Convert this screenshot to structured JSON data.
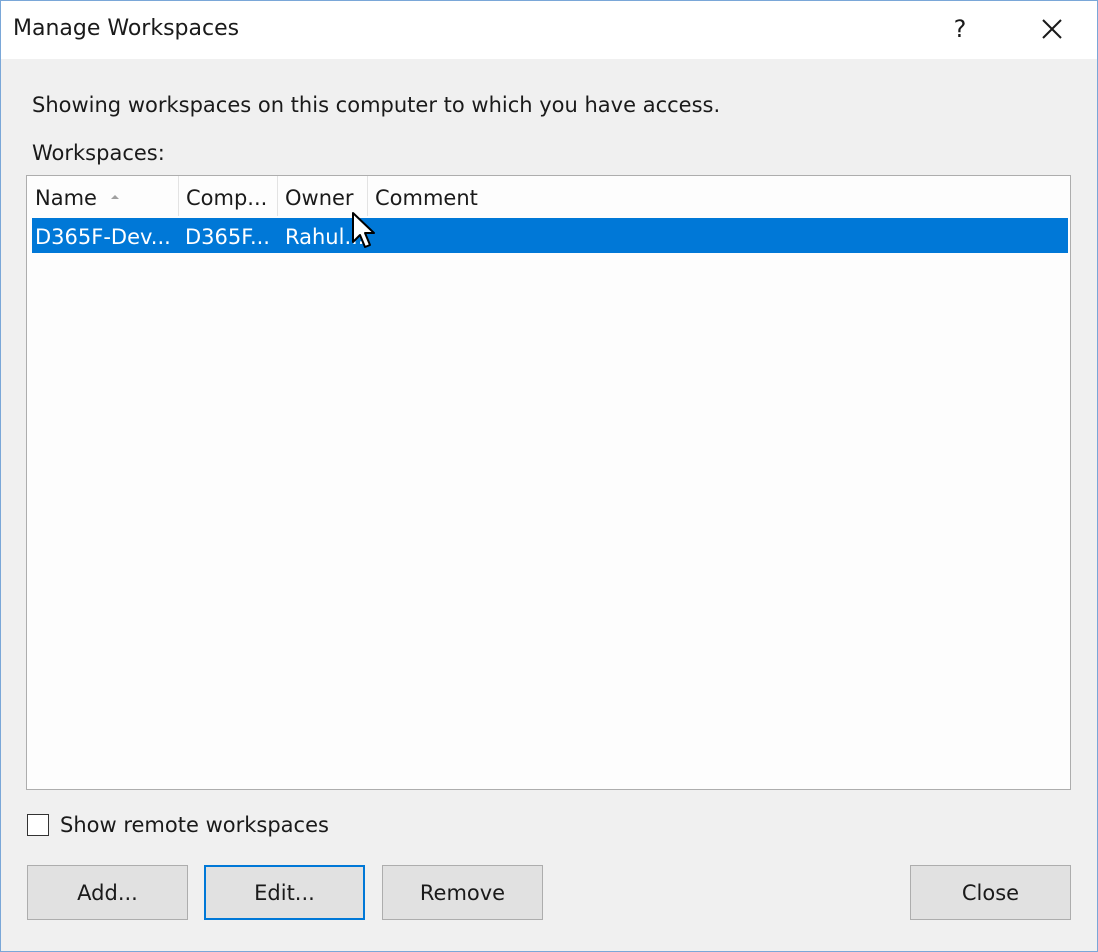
{
  "window": {
    "title": "Manage Workspaces",
    "help_label": "?"
  },
  "intro_text": "Showing workspaces on this computer to which you have access.",
  "workspaces_label": "Workspaces:",
  "list": {
    "columns": [
      "Name",
      "Comp...",
      "Owner",
      "Comment"
    ],
    "sort_column": "Name",
    "sort_direction": "ascending",
    "rows": [
      {
        "name": "D365F-Dev...",
        "computer": "D365F...",
        "owner": "Rahul...",
        "comment": "",
        "selected": true
      }
    ]
  },
  "show_remote": {
    "label": "Show remote workspaces",
    "checked": false
  },
  "buttons": {
    "add": "Add...",
    "edit": "Edit...",
    "remove": "Remove",
    "close": "Close"
  },
  "colors": {
    "selection": "#0078d7",
    "background": "#f0f0f0",
    "titlebar": "#ffffff"
  },
  "icons": {
    "close": "close-icon",
    "sort": "sort-ascending-icon",
    "cursor": "mouse-pointer-icon"
  }
}
